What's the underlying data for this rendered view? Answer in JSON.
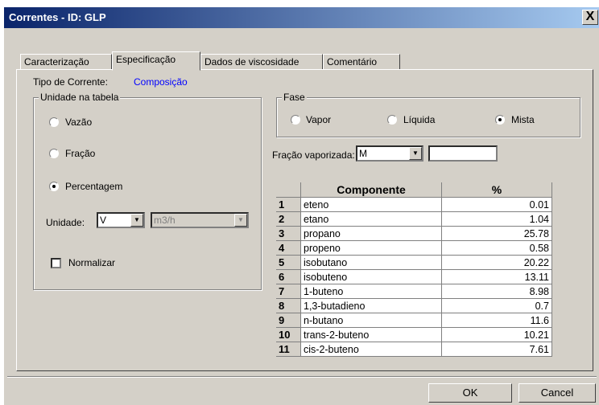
{
  "window": {
    "title": "Correntes - ID: GLP",
    "close_label": "X"
  },
  "tabs": [
    {
      "label": "Caracterização",
      "active": false
    },
    {
      "label": "Especificação",
      "active": true
    },
    {
      "label": "Dados de viscosidade",
      "active": false
    },
    {
      "label": "Comentário",
      "active": false
    }
  ],
  "tipo_corrente": {
    "label": "Tipo de Corrente:",
    "value": "Composição"
  },
  "unidade_group": {
    "legend": "Unidade na tabela",
    "options": [
      {
        "label": "Vazão",
        "selected": false
      },
      {
        "label": "Fração",
        "selected": false
      },
      {
        "label": "Percentagem",
        "selected": true
      }
    ],
    "unidade_label": "Unidade:",
    "unidade_value": "V",
    "unit_value": "m3/h",
    "normalizar_label": "Normalizar",
    "normalizar_checked": false
  },
  "fase_group": {
    "legend": "Fase",
    "options": [
      {
        "label": "Vapor",
        "selected": false
      },
      {
        "label": "Líquida",
        "selected": false
      },
      {
        "label": "Mista",
        "selected": true
      }
    ]
  },
  "fracao": {
    "label": "Fração vaporizada:",
    "combo_value": "M",
    "input_value": ""
  },
  "table": {
    "headers": [
      "Componente",
      "%"
    ],
    "rows": [
      {
        "index": "1",
        "name": "eteno",
        "pct": "0.01"
      },
      {
        "index": "2",
        "name": "etano",
        "pct": "1.04"
      },
      {
        "index": "3",
        "name": "propano",
        "pct": "25.78"
      },
      {
        "index": "4",
        "name": "propeno",
        "pct": "0.58"
      },
      {
        "index": "5",
        "name": "isobutano",
        "pct": "20.22"
      },
      {
        "index": "6",
        "name": "isobuteno",
        "pct": "13.11"
      },
      {
        "index": "7",
        "name": "1-buteno",
        "pct": "8.98"
      },
      {
        "index": "8",
        "name": "1,3-butadieno",
        "pct": "0.7"
      },
      {
        "index": "9",
        "name": "n-butano",
        "pct": "11.6"
      },
      {
        "index": "10",
        "name": "trans-2-buteno",
        "pct": "10.21"
      },
      {
        "index": "11",
        "name": "cis-2-buteno",
        "pct": "7.61"
      }
    ]
  },
  "buttons": {
    "ok": "OK",
    "cancel": "Cancel"
  }
}
